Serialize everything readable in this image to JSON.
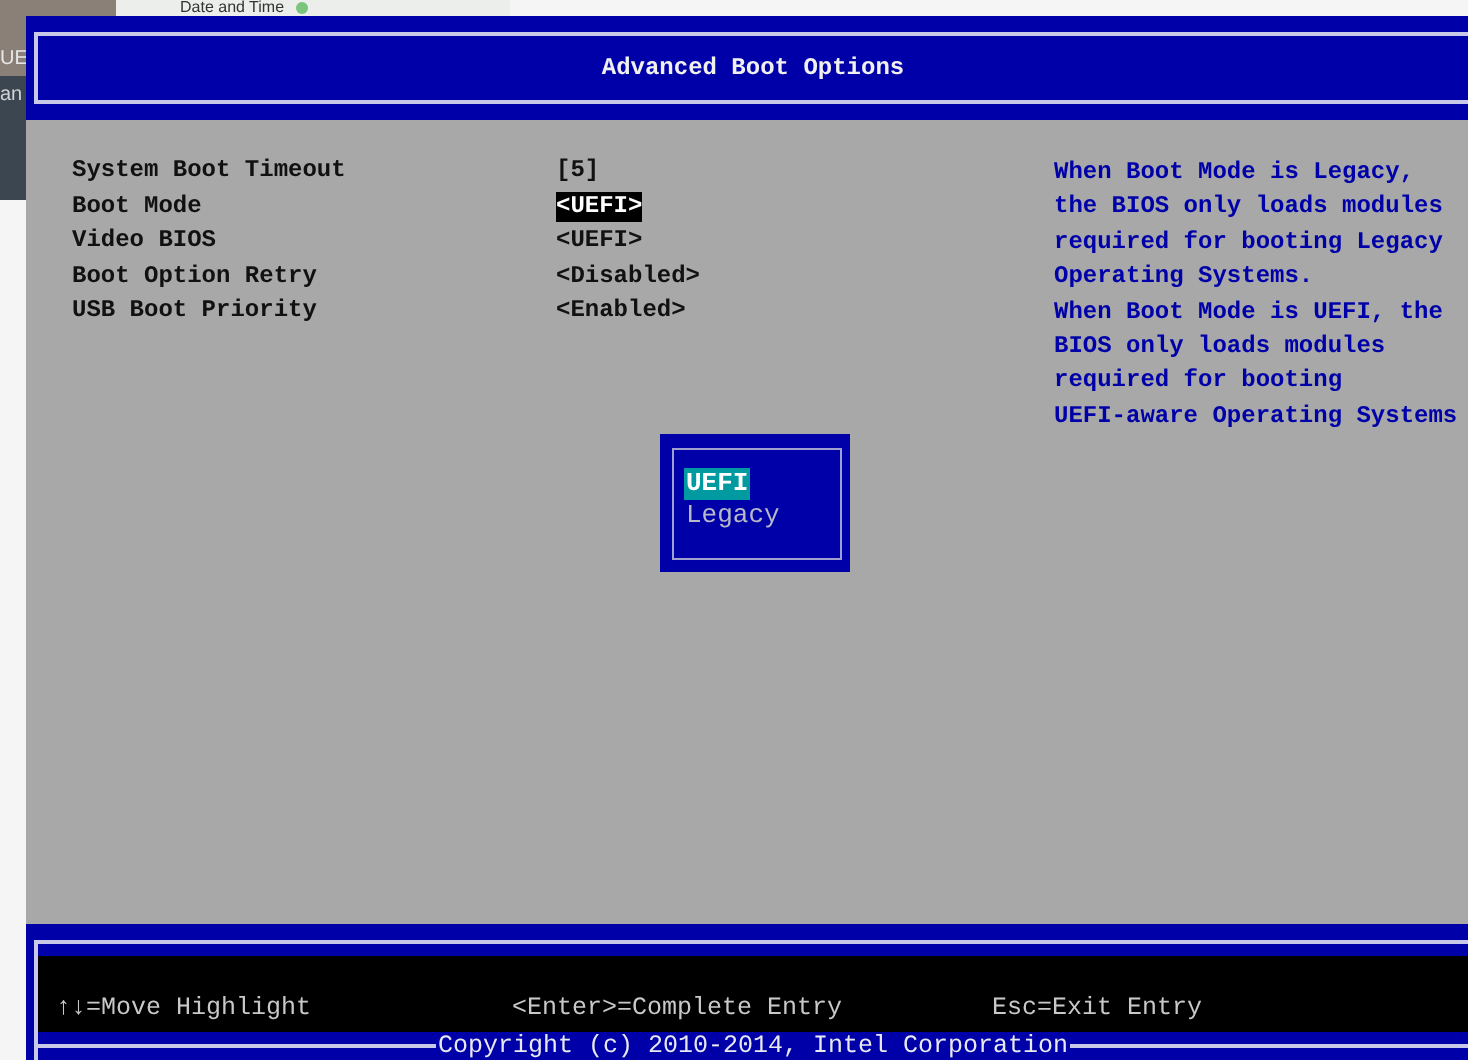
{
  "background_window": {
    "title": "Date and Time",
    "sidebar_items": [
      "UE",
      "an"
    ]
  },
  "bios": {
    "title": "Advanced Boot Options",
    "settings": [
      {
        "label": "System Boot Timeout",
        "value": "[5]",
        "selected": false
      },
      {
        "label": "Boot Mode",
        "value": "<UEFI>",
        "selected": true
      },
      {
        "label": "Video BIOS",
        "value": "<UEFI>",
        "selected": false
      },
      {
        "label": "Boot Option Retry",
        "value": "<Disabled>",
        "selected": false
      },
      {
        "label": "USB Boot Priority",
        "value": "<Enabled>",
        "selected": false
      }
    ],
    "help_lines": [
      "When Boot Mode is Legacy,",
      "the BIOS only loads modules",
      "required for booting Legacy",
      "Operating Systems.",
      "When Boot Mode is UEFI, the",
      "BIOS only loads modules",
      "required for booting",
      "UEFI-aware Operating Systems"
    ],
    "popup": {
      "options": [
        {
          "label": "UEFI",
          "selected": true
        },
        {
          "label": "Legacy",
          "selected": false
        }
      ]
    },
    "key_hints": [
      "↑↓=Move Highlight",
      "<Enter>=Complete Entry",
      "Esc=Exit Entry"
    ],
    "copyright": "Copyright (c) 2010-2014, Intel Corporation"
  }
}
